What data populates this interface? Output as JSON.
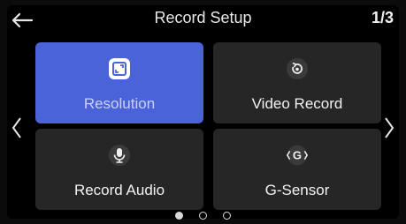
{
  "header": {
    "title": "Record Setup",
    "page": "1/3"
  },
  "tiles": [
    {
      "label": "Resolution",
      "icon": "resolution-icon",
      "selected": true
    },
    {
      "label": "Video Record",
      "icon": "video-record-icon",
      "selected": false
    },
    {
      "label": "Record Audio",
      "icon": "microphone-icon",
      "selected": false
    },
    {
      "label": "G-Sensor",
      "icon": "g-sensor-icon",
      "selected": false,
      "icon_text": "G"
    }
  ],
  "pagination": {
    "count": 3,
    "current": 1
  },
  "colors": {
    "accent": "#4b63d8",
    "tile": "#262626",
    "background": "#000000"
  }
}
